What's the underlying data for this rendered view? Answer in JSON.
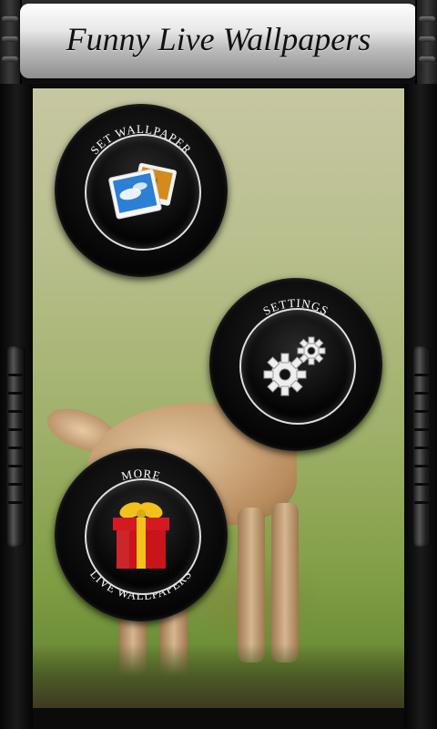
{
  "header": {
    "title": "Funny Live Wallpapers"
  },
  "buttons": {
    "set_wallpaper": {
      "label": "SET WALLPAPER",
      "icon": "photos-icon"
    },
    "settings": {
      "label": "SETTINGS",
      "icon": "gears-icon"
    },
    "more": {
      "label_top": "MORE",
      "label_bottom": "LIVE WALLPAPERS",
      "icon": "gift-icon"
    }
  },
  "colors": {
    "button_bg": "#050505",
    "ring": "#e0e0e0",
    "gift_red": "#c8141a",
    "ribbon_gold": "#f2c21a"
  }
}
